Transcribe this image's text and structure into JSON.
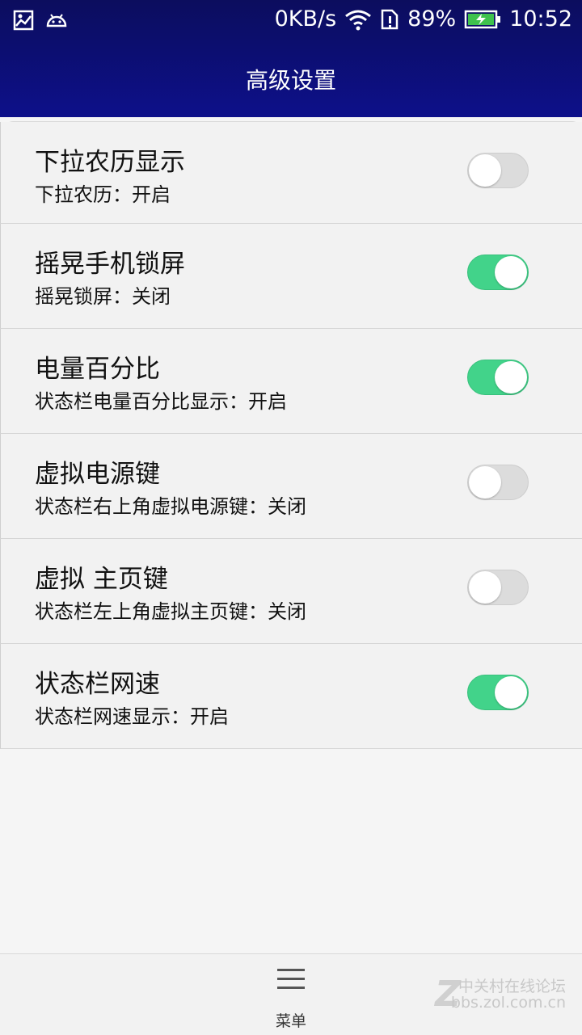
{
  "status_bar": {
    "net_speed": "0KB/s",
    "battery_percent": "89%",
    "time": "10:52"
  },
  "header": {
    "title": "高级设置"
  },
  "settings": [
    {
      "title": "下拉农历显示",
      "subtitle": "下拉农历：开启",
      "enabled": false
    },
    {
      "title": "摇晃手机锁屏",
      "subtitle": "摇晃锁屏：关闭",
      "enabled": true
    },
    {
      "title": "电量百分比",
      "subtitle": "状态栏电量百分比显示：开启",
      "enabled": true
    },
    {
      "title": "虚拟电源键",
      "subtitle": "状态栏右上角虚拟电源键：关闭",
      "enabled": false
    },
    {
      "title": "虚拟 主页键",
      "subtitle": "状态栏左上角虚拟主页键：关闭",
      "enabled": false
    },
    {
      "title": "状态栏网速",
      "subtitle": "状态栏网速显示：开启",
      "enabled": true
    }
  ],
  "bottom_bar": {
    "menu_label": "菜单"
  },
  "watermark": {
    "line1": "中关村在线论坛",
    "line2": "bbs.zol.com.cn"
  },
  "colors": {
    "header": "#0d108a",
    "toggle_on": "#42d38a",
    "toggle_off": "#dcdcdc"
  }
}
